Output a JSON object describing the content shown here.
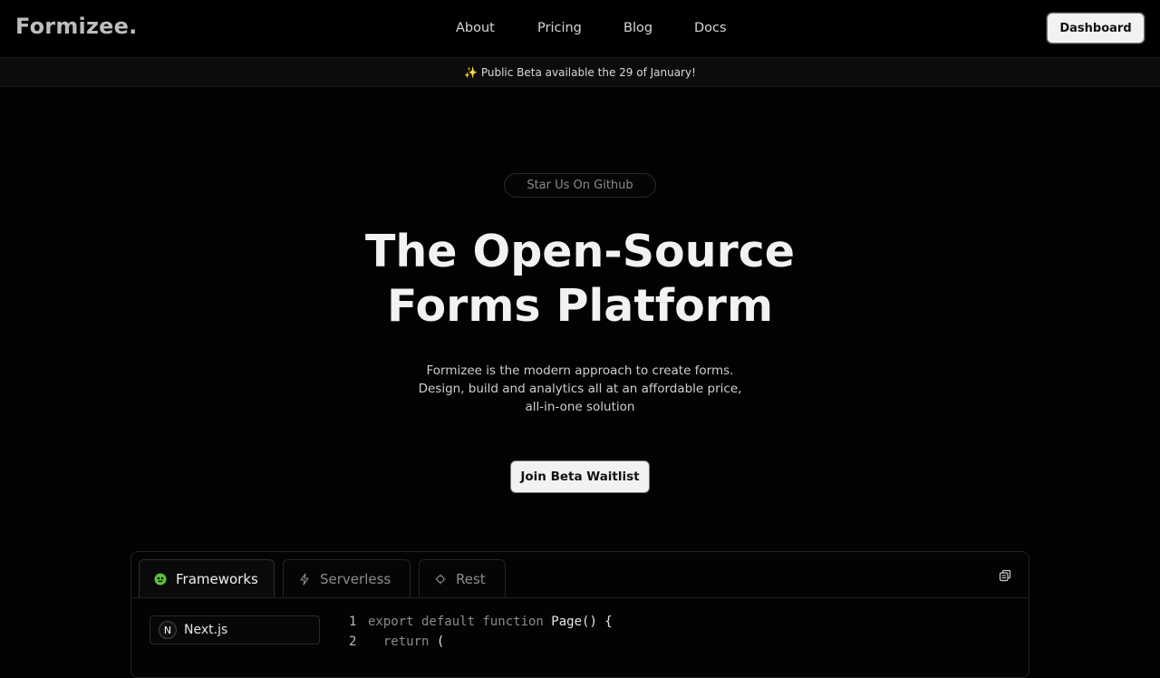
{
  "header": {
    "logo": "Formizee.",
    "nav": [
      {
        "label": "About"
      },
      {
        "label": "Pricing"
      },
      {
        "label": "Blog"
      },
      {
        "label": "Docs"
      }
    ],
    "dashboard_button": "Dashboard"
  },
  "banner": {
    "text": "✨ Public Beta available the 29 of January!"
  },
  "hero": {
    "badge": "Star Us On Github",
    "title_line1": "The Open-Source",
    "title_line2": "Forms Platform",
    "subtitle_line1": "Formizee is the modern approach to create forms.",
    "subtitle_line2": "Design, build and analytics all at an affordable price,",
    "subtitle_line3": "all-in-one solution",
    "cta": "Join Beta Waitlist"
  },
  "code_panel": {
    "tabs": [
      {
        "label": "Frameworks",
        "icon": "framework-icon",
        "active": true
      },
      {
        "label": "Serverless",
        "icon": "lightning-icon",
        "active": false
      },
      {
        "label": "Rest",
        "icon": "gear-icon",
        "active": false
      }
    ],
    "copy_icon": "copy-icon",
    "frameworks": [
      {
        "label": "Next.js",
        "icon_letter": "N"
      }
    ],
    "code_lines": [
      {
        "num": "1",
        "keyword": "export default function ",
        "rest": "Page() {"
      },
      {
        "num": "2",
        "keyword": "  return ",
        "rest": "("
      }
    ]
  },
  "colors": {
    "background": "#020202",
    "accent_green": "#5fbf3b",
    "button_bg": "#f2f2f2"
  }
}
